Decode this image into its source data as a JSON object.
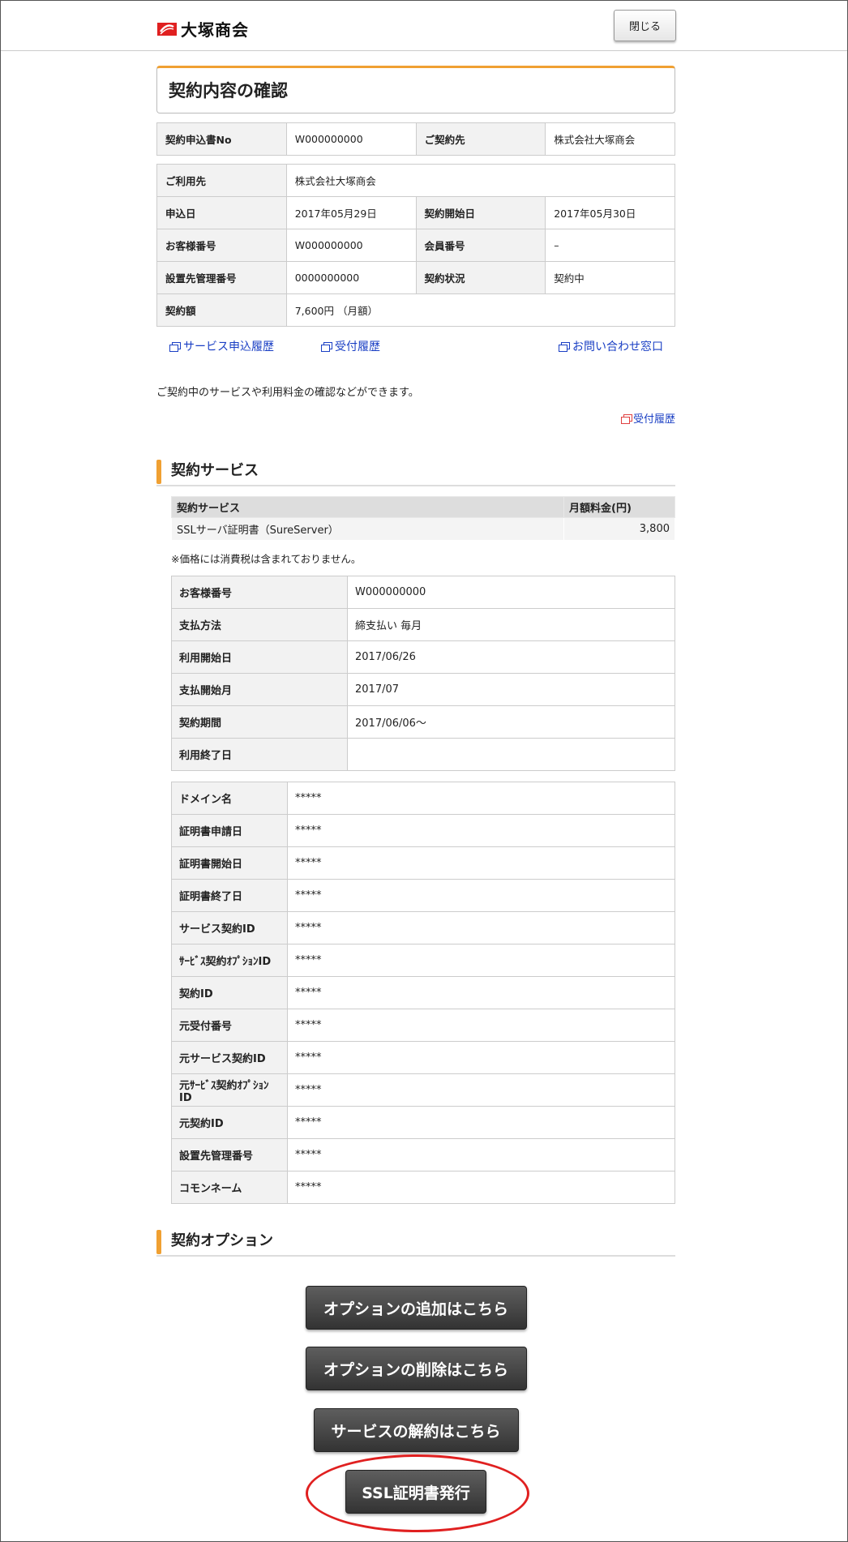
{
  "header": {
    "logo_text": "大塚商会",
    "close_label": "閉じる",
    "brand_color": "#e02020"
  },
  "page_title": "契約内容の確認",
  "contract_summary": [
    [
      {
        "label": "契約申込書No",
        "value": "W000000000"
      },
      {
        "label": "ご契約先",
        "value": "株式会社大塚商会"
      }
    ]
  ],
  "contract_details": {
    "user_label": "ご利用先",
    "user_value": "株式会社大塚商会",
    "rows": [
      [
        {
          "label": "申込日",
          "value": "2017年05月29日"
        },
        {
          "label": "契約開始日",
          "value": "2017年05月30日"
        }
      ],
      [
        {
          "label": "お客様番号",
          "value": "W000000000"
        },
        {
          "label": "会員番号",
          "value": "–"
        }
      ],
      [
        {
          "label": "設置先管理番号",
          "value": "0000000000"
        },
        {
          "label": "契約状況",
          "value": "契約中"
        }
      ]
    ],
    "amount_label": "契約額",
    "amount_value": "7,600円 （月額）"
  },
  "links": {
    "history": "サービス申込履歴",
    "reception": "受付履歴",
    "inquiry": "お問い合わせ窓口",
    "reception_right": "受付履歴"
  },
  "description": "ご契約中のサービスや利用料金の確認などができます。",
  "service_section": {
    "title": "契約サービス",
    "col_service": "契約サービス",
    "col_fee": "月額料金(円)",
    "service_name": "SSLサーバ証明書（SureServer）",
    "service_fee": "3,800",
    "note": "※価格には消費税は含まれておりません。",
    "billing": [
      {
        "label": "お客様番号",
        "value": "W000000000"
      },
      {
        "label": "支払方法",
        "value": "締支払い 毎月"
      },
      {
        "label": "利用開始日",
        "value": "2017/06/26"
      },
      {
        "label": "支払開始月",
        "value": "2017/07"
      },
      {
        "label": "契約期間",
        "value": "2017/06/06～"
      },
      {
        "label": "利用終了日",
        "value": ""
      }
    ],
    "cert": [
      {
        "label": "ドメイン名",
        "value": "*****"
      },
      {
        "label": "証明書申請日",
        "value": "*****"
      },
      {
        "label": "証明書開始日",
        "value": "*****"
      },
      {
        "label": "証明書終了日",
        "value": "*****"
      },
      {
        "label": "サービス契約ID",
        "value": "*****"
      },
      {
        "label": "ｻｰﾋﾞｽ契約ｵﾌﾟｼｮﾝID",
        "value": "*****"
      },
      {
        "label": "契約ID",
        "value": "*****"
      },
      {
        "label": "元受付番号",
        "value": "*****"
      },
      {
        "label": "元サービス契約ID",
        "value": "*****"
      },
      {
        "label": "元ｻｰﾋﾞｽ契約ｵﾌﾟｼｮﾝID",
        "value": "*****"
      },
      {
        "label": "元契約ID",
        "value": "*****"
      },
      {
        "label": "設置先管理番号",
        "value": "*****"
      },
      {
        "label": "コモンネーム",
        "value": "*****"
      }
    ]
  },
  "option_section": {
    "title": "契約オプション",
    "add_option": "オプションの追加はこちら",
    "remove_option": "オプションの削除はこちら",
    "cancel_service": "サービスの解約はこちら",
    "issue_ssl": "SSL証明書発行"
  },
  "colors": {
    "accent_orange": "#f0a032",
    "link_blue": "#1a3fc4",
    "highlight_red": "#e02020"
  }
}
